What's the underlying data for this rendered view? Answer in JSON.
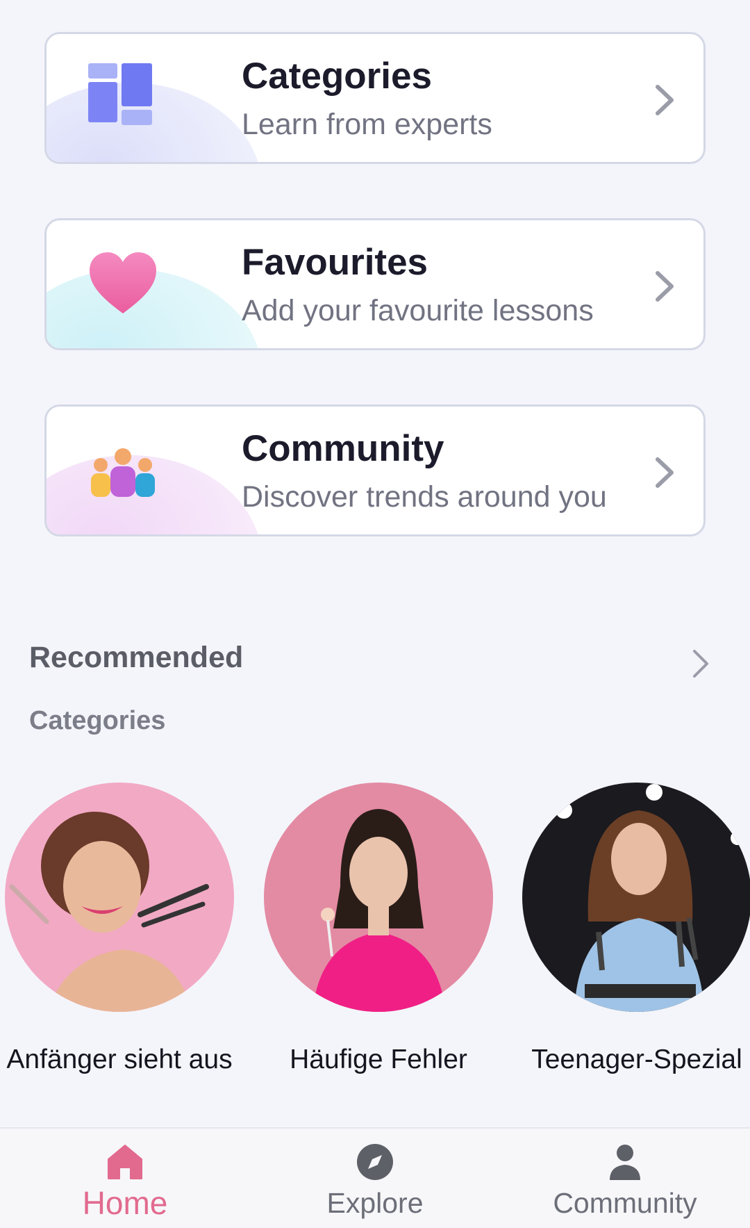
{
  "cards": [
    {
      "title": "Categories",
      "subtitle": "Learn from experts",
      "icon": "grid-icon",
      "accent": "#7c84f5"
    },
    {
      "title": "Favourites",
      "subtitle": "Add your favourite lessons",
      "icon": "heart-icon",
      "accent": "#f16aa6"
    },
    {
      "title": "Community",
      "subtitle": "Discover trends around you",
      "icon": "people-icon",
      "accent": "#c062d8"
    }
  ],
  "recommended": {
    "title": "Recommended",
    "subtitle": "Categories",
    "items": [
      {
        "label": "Anfänger sieht aus"
      },
      {
        "label": "Häufige Fehler"
      },
      {
        "label": "Teenager-Spezial"
      }
    ]
  },
  "nav": {
    "items": [
      {
        "label": "Home",
        "icon": "home-icon",
        "active": true
      },
      {
        "label": "Explore",
        "icon": "compass-icon",
        "active": false
      },
      {
        "label": "Community",
        "icon": "user-icon",
        "active": false
      }
    ],
    "active_color": "#e26a8f"
  }
}
